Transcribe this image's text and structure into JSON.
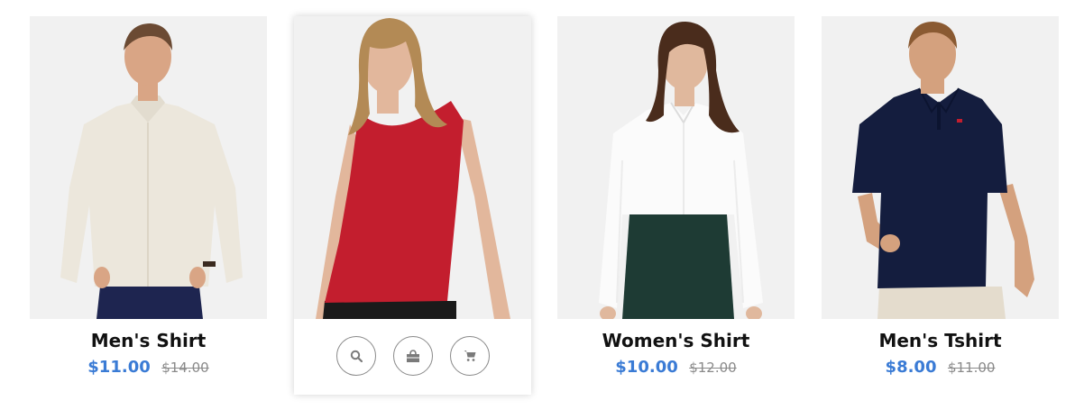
{
  "products": [
    {
      "title": "Men's Shirt",
      "price": "$11.00",
      "old_price": "$14.00",
      "image_icon": "man-white-shirt-photo",
      "colors": {
        "shirt": "#ece7dc",
        "pants": "#1e2550",
        "skin": "#d9a585",
        "hair": "#6b4a33"
      }
    },
    {
      "title": "",
      "image_icon": "woman-red-top-photo",
      "colors": {
        "top": "#c31e2e",
        "pants": "#1a1a1a",
        "skin": "#e2b79c",
        "hair": "#b38a55"
      },
      "actions": [
        {
          "icon": "search-icon"
        },
        {
          "icon": "bag-icon"
        },
        {
          "icon": "cart-icon"
        }
      ]
    },
    {
      "title": "Women's Shirt",
      "price": "$10.00",
      "old_price": "$12.00",
      "image_icon": "woman-white-shirt-photo",
      "colors": {
        "shirt": "#fbfbfb",
        "skirt": "#1e3b34",
        "skin": "#e0b89d",
        "hair": "#4a2c1c"
      }
    },
    {
      "title": "Men's Tshirt",
      "price": "$8.00",
      "old_price": "$11.00",
      "image_icon": "man-navy-polo-photo",
      "colors": {
        "shirt": "#141d3e",
        "pants": "#e4dccd",
        "skin": "#d4a17e",
        "hair": "#8a5a32"
      }
    }
  ],
  "accent_color": "#3a7bd5",
  "old_price_color": "#8a8a8a"
}
